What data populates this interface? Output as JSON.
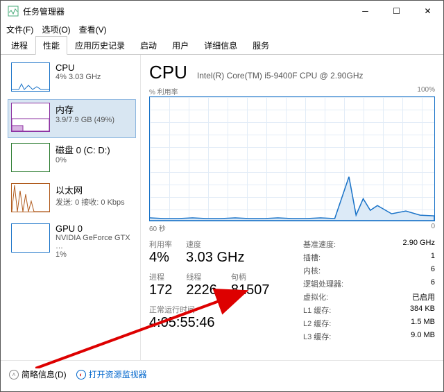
{
  "window": {
    "title": "任务管理器"
  },
  "menubar": {
    "file": "文件(F)",
    "options": "选项(O)",
    "view": "查看(V)"
  },
  "tabs": {
    "processes": "进程",
    "performance": "性能",
    "appHistory": "应用历史记录",
    "startup": "启动",
    "users": "用户",
    "details": "详细信息",
    "services": "服务"
  },
  "sidebar": {
    "cpu": {
      "name": "CPU",
      "sub": "4% 3.03 GHz"
    },
    "mem": {
      "name": "内存",
      "sub": "3.9/7.9 GB (49%)"
    },
    "disk": {
      "name": "磁盘 0 (C: D:)",
      "sub": "0%"
    },
    "eth": {
      "name": "以太网",
      "sub": "发送: 0 接收: 0 Kbps"
    },
    "gpu": {
      "name": "GPU 0",
      "sub": "NVIDIA GeForce GTX …",
      "sub2": "1%"
    }
  },
  "main": {
    "title": "CPU",
    "subtitle": "Intel(R) Core(TM) i5-9400F CPU @ 2.90GHz",
    "chart": {
      "topLeft": "% 利用率",
      "topRight": "100%",
      "bottomLeft": "60 秒",
      "bottomRight": "0"
    },
    "stats": {
      "util": {
        "label": "利用率",
        "val": "4%"
      },
      "speed": {
        "label": "速度",
        "val": "3.03 GHz"
      },
      "processes": {
        "label": "进程",
        "val": "172"
      },
      "threads": {
        "label": "线程",
        "val": "2226"
      },
      "handles": {
        "label": "句柄",
        "val": "81507"
      },
      "uptime": {
        "label": "正常运行时间",
        "val": "4:05:55:46"
      }
    },
    "info": {
      "baseSpeed": {
        "k": "基准速度:",
        "v": "2.90 GHz"
      },
      "sockets": {
        "k": "插槽:",
        "v": "1"
      },
      "cores": {
        "k": "内核:",
        "v": "6"
      },
      "logical": {
        "k": "逻辑处理器:",
        "v": "6"
      },
      "virt": {
        "k": "虚拟化:",
        "v": "已启用"
      },
      "l1": {
        "k": "L1 缓存:",
        "v": "384 KB"
      },
      "l2": {
        "k": "L2 缓存:",
        "v": "1.5 MB"
      },
      "l3": {
        "k": "L3 缓存:",
        "v": "9.0 MB"
      }
    }
  },
  "footer": {
    "less": "简略信息(D)",
    "resmon": "打开资源监视器"
  },
  "chart_data": {
    "type": "line",
    "title": "% 利用率",
    "xlabel": "60 秒",
    "ylabel": "% 利用率",
    "ylim": [
      0,
      100
    ],
    "x": [
      0,
      2,
      4,
      6,
      8,
      10,
      12,
      14,
      16,
      18,
      20,
      22,
      24,
      26,
      28,
      30,
      32,
      34,
      36,
      38,
      40,
      42,
      44,
      46,
      48,
      50,
      52,
      54,
      56,
      58,
      60
    ],
    "values": [
      3,
      2,
      2,
      3,
      2,
      2,
      3,
      2,
      2,
      3,
      2,
      2,
      3,
      2,
      2,
      3,
      2,
      2,
      3,
      2,
      2,
      3,
      2,
      35,
      5,
      18,
      10,
      12,
      6,
      8,
      5
    ]
  }
}
